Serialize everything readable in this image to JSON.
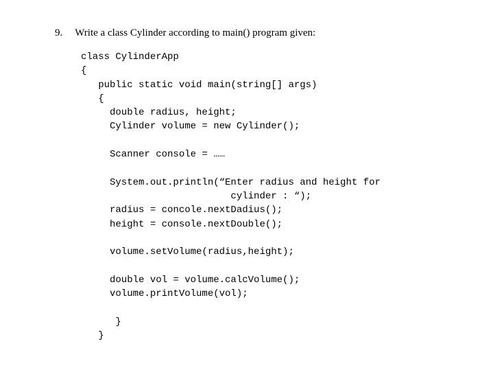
{
  "question": {
    "number": "9.",
    "text": "Write a class Cylinder according to main() program given:"
  },
  "code": {
    "line1": "class CylinderApp",
    "line2": "{",
    "line3": "   public static void main(string[] args)",
    "line4": "   {",
    "line5": "     double radius, height;",
    "line6": "     Cylinder volume = new Cylinder();",
    "line7": "",
    "line8": "     Scanner console = ……",
    "line9": "",
    "line10": "     System.out.println(“Enter radius and height for",
    "line11": "                          cylinder : “);",
    "line12": "     radius = concole.nextDadius();",
    "line13": "     height = console.nextDouble();",
    "line14": "",
    "line15": "     volume.setVolume(radius,height);",
    "line16": "",
    "line17": "     double vol = volume.calcVolume();",
    "line18": "     volume.printVolume(vol);",
    "line19": "",
    "line20": "      }",
    "line21": "   }"
  }
}
